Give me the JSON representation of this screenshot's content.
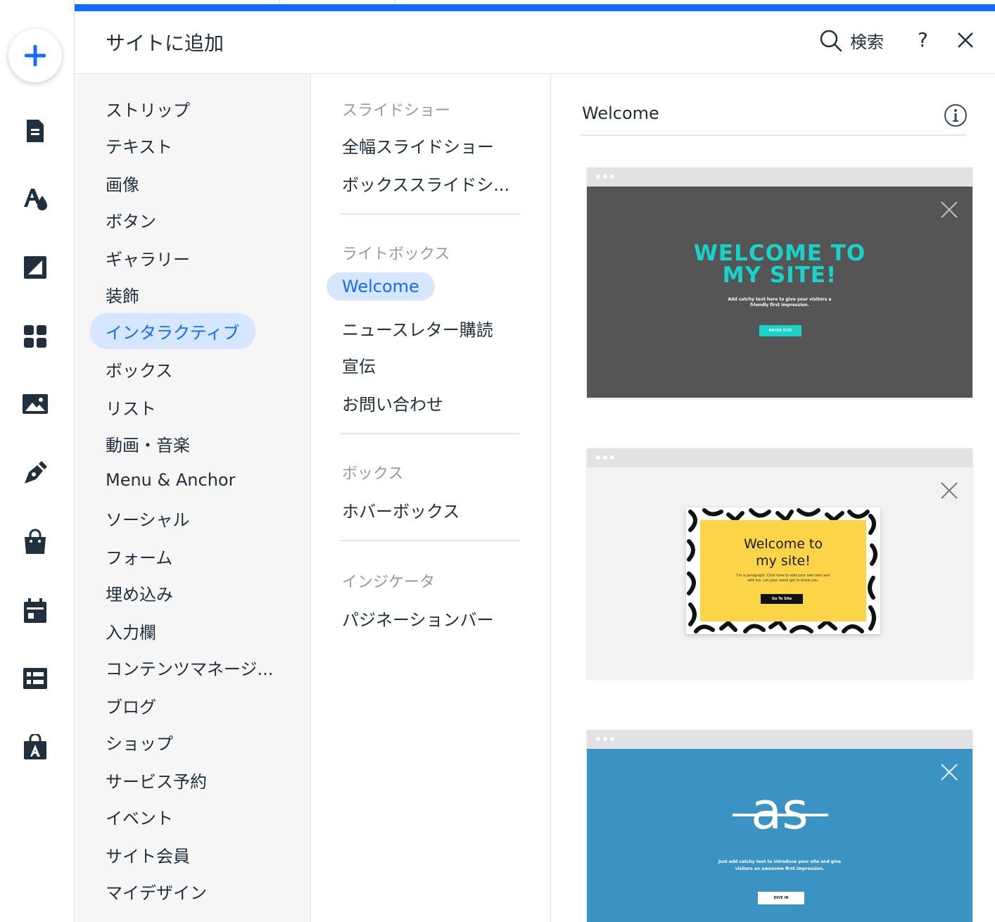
{
  "header": {
    "title": "サイトに追加",
    "search_label": "検索",
    "help_label": "?"
  },
  "rail": {
    "add_icon": "plus-icon",
    "icons": [
      "pages-icon",
      "theme-icon",
      "background-icon",
      "apps-icon",
      "media-icon",
      "pen-icon",
      "store-icon",
      "calendar-icon",
      "table-icon",
      "app-market-icon"
    ],
    "accent": "#116dff"
  },
  "categories": [
    "ストリップ",
    "テキスト",
    "画像",
    "ボタン",
    "ギャラリー",
    "装飾",
    "インタラクティブ",
    "ボックス",
    "リスト",
    "動画・音楽",
    "Menu & Anchor",
    "ソーシャル",
    "フォーム",
    "埋め込み",
    "入力欄",
    "コンテンツマネージ...",
    "ブログ",
    "ショップ",
    "サービス予約",
    "イベント",
    "サイト会員",
    "マイデザイン"
  ],
  "active_category": "インタラクティブ",
  "sections": [
    {
      "title": "スライドショー",
      "items": [
        "全幅スライドショー",
        "ボックススライドシ..."
      ]
    },
    {
      "title": "ライトボックス",
      "items": [
        "Welcome",
        "ニュースレター購読",
        "宣伝",
        "お問い合わせ"
      ]
    },
    {
      "title": "ボックス",
      "items": [
        "ホバーボックス"
      ]
    },
    {
      "title": "インジケータ",
      "items": [
        "パジネーションバー"
      ]
    }
  ],
  "active_item": "Welcome",
  "preview": {
    "title": "Welcome",
    "cards": [
      {
        "heading_line1": "WELCOME TO",
        "heading_line2": "MY SITE!",
        "text_line1": "Add catchy text here to give your visitors a",
        "text_line2": "friendly first impression.",
        "button": "ENTER SITE"
      },
      {
        "heading_line1": "Welcome to",
        "heading_line2": "my site!",
        "text_line1": "I'm a paragraph. Click here to add your own text and",
        "text_line2": "edit me. Let your users get to know you.",
        "button": "Go To Site"
      },
      {
        "logo": "as",
        "text_line1": "Just add catchy text to introduce your site and give",
        "text_line2": "visitors an awesome first impression.",
        "button": "DIVE IN"
      }
    ]
  }
}
